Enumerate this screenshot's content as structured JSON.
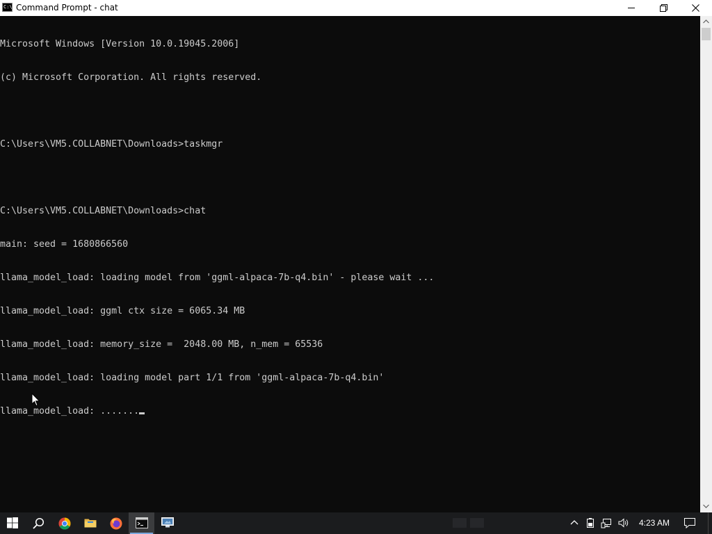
{
  "window": {
    "title": "Command Prompt - chat",
    "icon": "cmd-icon",
    "icon_text": "C:\\",
    "buttons": [
      "minimize-icon",
      "restore-icon",
      "close-icon"
    ]
  },
  "console": {
    "background": "#0c0c0c",
    "foreground": "#cccccc",
    "lines": [
      "Microsoft Windows [Version 10.0.19045.2006]",
      "(c) Microsoft Corporation. All rights reserved.",
      "",
      "C:\\Users\\VM5.COLLABNET\\Downloads>taskmgr",
      "",
      "C:\\Users\\VM5.COLLABNET\\Downloads>chat",
      "main: seed = 1680866560",
      "llama_model_load: loading model from 'ggml-alpaca-7b-q4.bin' - please wait ...",
      "llama_model_load: ggml ctx size = 6065.34 MB",
      "llama_model_load: memory_size =  2048.00 MB, n_mem = 65536",
      "llama_model_load: loading model part 1/1 from 'ggml-alpaca-7b-q4.bin'",
      "llama_model_load: ......."
    ]
  },
  "taskbar": {
    "items": [
      {
        "name": "start-button",
        "icon": "windows-logo-icon"
      },
      {
        "name": "search-button",
        "icon": "search-icon"
      },
      {
        "name": "chrome-button",
        "icon": "chrome-icon"
      },
      {
        "name": "file-explorer-button",
        "icon": "folder-icon"
      },
      {
        "name": "firefox-button",
        "icon": "firefox-icon"
      },
      {
        "name": "command-prompt-button",
        "icon": "cmd-icon",
        "active": true
      },
      {
        "name": "remote-desktop-button",
        "icon": "remote-desktop-icon"
      }
    ],
    "tray": {
      "icons": [
        "chevron-up-icon",
        "battery-icon",
        "network-icon",
        "volume-icon",
        "notification-icon"
      ],
      "clock": "4:23 AM"
    },
    "accent": "#7aa7dd"
  }
}
